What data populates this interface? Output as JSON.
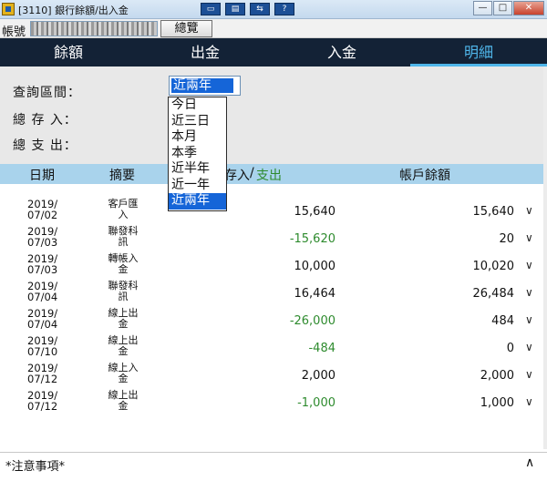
{
  "window": {
    "title": "[3110] 銀行餘額/出入金",
    "toolbar_icons": [
      "window-icon",
      "layout-icon",
      "link-icon",
      "help-icon"
    ],
    "controls": {
      "minimize": "—",
      "restore": "□",
      "close": "✕"
    }
  },
  "account": {
    "label": "帳號",
    "overview_button": "總覽"
  },
  "tabs": [
    {
      "label": "餘額",
      "active": false
    },
    {
      "label": "出金",
      "active": false
    },
    {
      "label": "入金",
      "active": false
    },
    {
      "label": "明細",
      "active": true
    }
  ],
  "query": {
    "period_label": "查詢區間：",
    "period_value": "近兩年",
    "total_in_label": "總 存 入：",
    "total_out_label": "總 支 出：",
    "options": [
      "今日",
      "近三日",
      "本月",
      "本季",
      "近半年",
      "近一年",
      "近兩年"
    ],
    "selected_option": "近兩年"
  },
  "columns": {
    "date": "日期",
    "memo": "摘要",
    "amount_in": "存入",
    "amount_sep": "/",
    "amount_out": "支出",
    "balance": "帳戶餘額"
  },
  "rows": [
    {
      "date_y": "2019/",
      "date_md": "07/02",
      "memo_1": "客戶匯",
      "memo_2": "入",
      "amount": "15,640",
      "balance": "15,640",
      "negative": false
    },
    {
      "date_y": "2019/",
      "date_md": "07/03",
      "memo_1": "聯發科",
      "memo_2": "訊",
      "amount": "-15,620",
      "balance": "20",
      "negative": true
    },
    {
      "date_y": "2019/",
      "date_md": "07/03",
      "memo_1": "轉帳入",
      "memo_2": "金",
      "amount": "10,000",
      "balance": "10,020",
      "negative": false
    },
    {
      "date_y": "2019/",
      "date_md": "07/04",
      "memo_1": "聯發科",
      "memo_2": "訊",
      "amount": "16,464",
      "balance": "26,484",
      "negative": false
    },
    {
      "date_y": "2019/",
      "date_md": "07/04",
      "memo_1": "線上出",
      "memo_2": "金",
      "amount": "-26,000",
      "balance": "484",
      "negative": true
    },
    {
      "date_y": "2019/",
      "date_md": "07/10",
      "memo_1": "線上出",
      "memo_2": "金",
      "amount": "-484",
      "balance": "0",
      "negative": true
    },
    {
      "date_y": "2019/",
      "date_md": "07/12",
      "memo_1": "線上入",
      "memo_2": "金",
      "amount": "2,000",
      "balance": "2,000",
      "negative": false
    },
    {
      "date_y": "2019/",
      "date_md": "07/12",
      "memo_1": "線上出",
      "memo_2": "金",
      "amount": "-1,000",
      "balance": "1,000",
      "negative": true
    }
  ],
  "footer": {
    "note": "*注意事項*"
  },
  "colors": {
    "tab_bar": "#132236",
    "accent": "#4fb6ea",
    "header_bg": "#a9d3ec",
    "negative": "#2e8b2e",
    "selection": "#1565d8"
  }
}
